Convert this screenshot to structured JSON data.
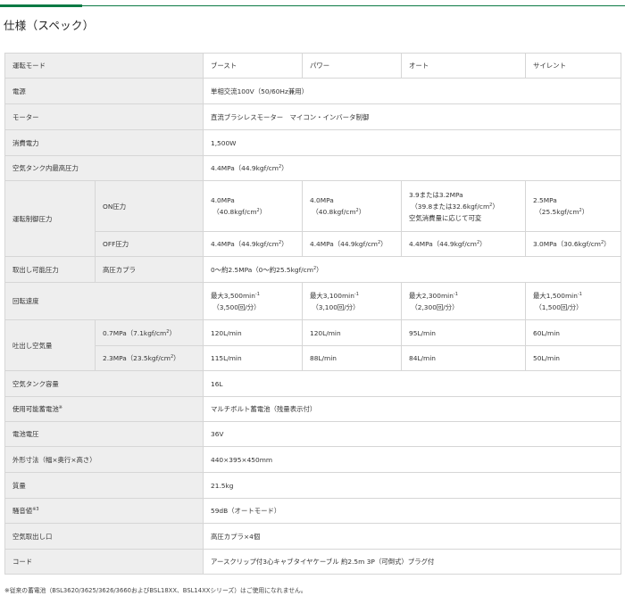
{
  "title": "仕様（スペック）",
  "header": {
    "label": "運転モード",
    "modes": [
      "ブースト",
      "パワー",
      "オート",
      "サイレント"
    ]
  },
  "power_source": {
    "label": "電源",
    "value": "単相交流100V（50/60Hz兼用）"
  },
  "motor": {
    "label": "モーター",
    "value": "直流ブラシレスモーター　マイコン・インバータ制御"
  },
  "consumption": {
    "label": "消費電力",
    "value": "1,500W"
  },
  "max_pressure": {
    "label": "空気タンク内最高圧力",
    "value_main": "4.4MPa（44.9kgf/cm",
    "value_sup": "2",
    "value_end": "）"
  },
  "control_pressure": {
    "label": "運転制御圧力",
    "on": {
      "label": "ON圧力",
      "cells": [
        {
          "l1": "4.0MPa",
          "l2": "（40.8kgf/cm",
          "sup": "2",
          "l2end": "）"
        },
        {
          "l1": "4.0MPa",
          "l2": "（40.8kgf/cm",
          "sup": "2",
          "l2end": "）"
        },
        {
          "l1": "3.9または3.2MPa",
          "l2": "（39.8または32.6kgf/cm",
          "sup": "2",
          "l2end": "）",
          "l3": "空気消費量に応じて可変"
        },
        {
          "l1": "2.5MPa",
          "l2": "（25.5kgf/cm",
          "sup": "2",
          "l2end": "）"
        }
      ]
    },
    "off": {
      "label": "OFF圧力",
      "cells": [
        {
          "t": "4.4MPa（44.9kgf/cm",
          "sup": "2",
          "end": "）"
        },
        {
          "t": "4.4MPa（44.9kgf/cm",
          "sup": "2",
          "end": "）"
        },
        {
          "t": "4.4MPa（44.9kgf/cm",
          "sup": "2",
          "end": "）"
        },
        {
          "t": "3.0MPa（30.6kgf/cm",
          "sup": "2",
          "end": "）"
        }
      ]
    }
  },
  "take_off": {
    "label": "取出し可能圧力",
    "sub": "高圧カプラ",
    "value_a": "0～約2.5MPa（0～約25.5kgf/cm",
    "value_sup": "2",
    "value_end": "）"
  },
  "rotation": {
    "label": "回転速度",
    "cells": [
      {
        "l1": "最大3,500min",
        "sup": "-1",
        "l2": "（3,500回/分）"
      },
      {
        "l1": "最大3,100min",
        "sup": "-1",
        "l2": "（3,100回/分）"
      },
      {
        "l1": "最大2,300min",
        "sup": "-1",
        "l2": "（2,300回/分）"
      },
      {
        "l1": "最大1,500min",
        "sup": "-1",
        "l2": "（1,500回/分）"
      }
    ]
  },
  "air_delivery": {
    "label": "吐出し空気量",
    "rows": [
      {
        "sub_a": "0.7MPa（7.1kgf/cm",
        "sub_sup": "2",
        "sub_end": "）",
        "values": [
          "120L/min",
          "120L/min",
          "95L/min",
          "60L/min"
        ]
      },
      {
        "sub_a": "2.3MPa（23.5kgf/cm",
        "sub_sup": "2",
        "sub_end": "）",
        "values": [
          "115L/min",
          "88L/min",
          "84L/min",
          "50L/min"
        ]
      }
    ]
  },
  "tank": {
    "label": "空気タンク容量",
    "value": "16L"
  },
  "battery": {
    "label": "使用可能蓄電池",
    "label_sup": "※",
    "value": "マルチボルト蓄電池（残量表示付）"
  },
  "battery_voltage": {
    "label": "電池電圧",
    "value": "36V"
  },
  "dimensions": {
    "label": "外形寸法（幅×奥行×高さ）",
    "value": "440×395×450mm"
  },
  "weight": {
    "label": "質量",
    "value": "21.5kg"
  },
  "noise": {
    "label": "騒音値",
    "label_sup": "※3",
    "value": "59dB（オートモード）"
  },
  "outlet": {
    "label": "空気取出し口",
    "value": "高圧カプラ×4個"
  },
  "cord": {
    "label": "コード",
    "value": "アースクリップ付3心キャブタイヤケーブル 約2.5m 3P（可倒式）プラグ付"
  },
  "footnote": "※従来の蓄電池（BSL3620/3625/3626/3660およびBSL18XX、BSL14XXシリーズ）はご使用になれません。",
  "colors": {
    "accent": "#0b7a44",
    "label_bg": "#eeeeee",
    "border": "#d6d6d6",
    "text": "#333333"
  }
}
